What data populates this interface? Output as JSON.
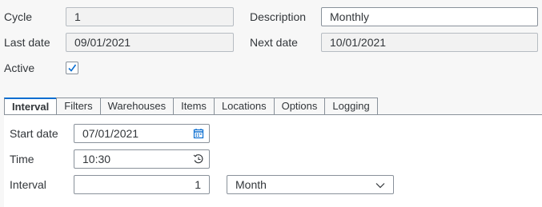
{
  "header": {
    "cycle_label": "Cycle",
    "cycle_value": "1",
    "description_label": "Description",
    "description_value": "Monthly",
    "last_date_label": "Last date",
    "last_date_value": "09/01/2021",
    "next_date_label": "Next date",
    "next_date_value": "10/01/2021",
    "active_label": "Active",
    "active_checked": true
  },
  "tabs": [
    {
      "label": "Interval",
      "active": true
    },
    {
      "label": "Filters"
    },
    {
      "label": "Warehouses"
    },
    {
      "label": "Items"
    },
    {
      "label": "Locations"
    },
    {
      "label": "Options"
    },
    {
      "label": "Logging"
    }
  ],
  "interval": {
    "start_date_label": "Start date",
    "start_date_value": "07/01/2021",
    "time_label": "Time",
    "time_value": "10:30",
    "interval_label": "Interval",
    "interval_value": "1",
    "unit_value": "Month"
  },
  "icons": {
    "calendar": "calendar-icon",
    "time": "time-entry-icon",
    "dropdown": "chevron-down-icon",
    "check": "checkmark-icon"
  },
  "colors": {
    "accent": "#0a6ed1",
    "border": "#89919a",
    "readonly_bg": "#f2f2f2"
  }
}
